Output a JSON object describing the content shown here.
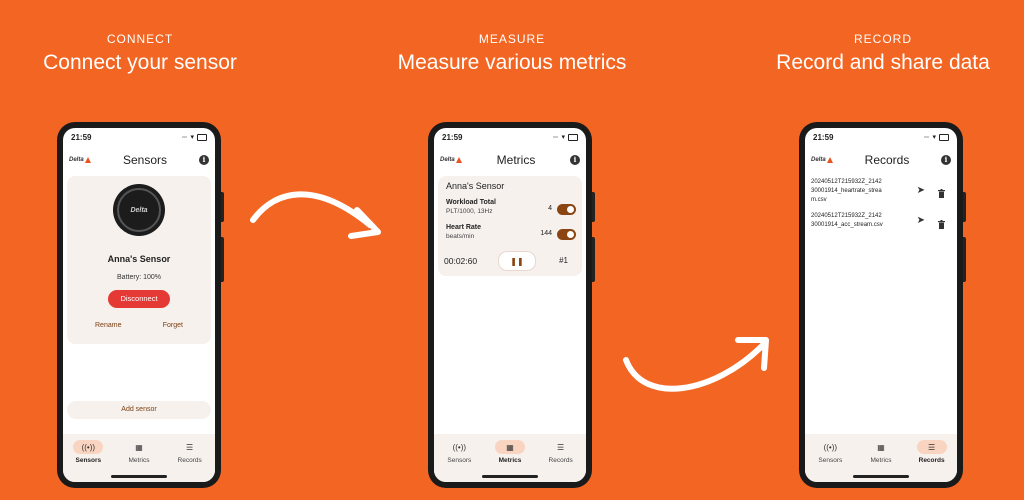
{
  "columns": [
    {
      "small": "CONNECT",
      "big": "Connect your sensor"
    },
    {
      "small": "MEASURE",
      "big": "Measure various metrics"
    },
    {
      "small": "RECORD",
      "big": "Record and share data"
    }
  ],
  "status_time": "21:59",
  "logo_text": "Delta",
  "nav": [
    "Sensors",
    "Metrics",
    "Records"
  ],
  "sensors_screen": {
    "title": "Sensors",
    "sensor_name": "Anna's Sensor",
    "battery": "Battery: 100%",
    "disconnect": "Disconnect",
    "rename": "Rename",
    "forget": "Forget",
    "add_sensor": "Add sensor"
  },
  "metrics_screen": {
    "title": "Metrics",
    "sensor_name": "Anna's Sensor",
    "metrics": [
      {
        "name": "Workload Total",
        "unit": "PLT/1000, 13Hz",
        "value": "4"
      },
      {
        "name": "Heart Rate",
        "unit": "beats/min",
        "value": "144"
      }
    ],
    "timer": "00:02:60",
    "pause_icon": "pause-icon",
    "record_number": "#1"
  },
  "records_screen": {
    "title": "Records",
    "records": [
      {
        "line1": "20240512T215932Z_2142",
        "line2": "30001914_heartrate_strea",
        "line3": "m.csv"
      },
      {
        "line1": "20240512T215932Z_2142",
        "line2": "30001914_acc_stream.csv"
      }
    ]
  },
  "colors": {
    "background": "#f26522",
    "accent": "#e8541e",
    "disconnect": "#e53935",
    "toggle": "#8b4512",
    "card": "#f7f1ee"
  }
}
